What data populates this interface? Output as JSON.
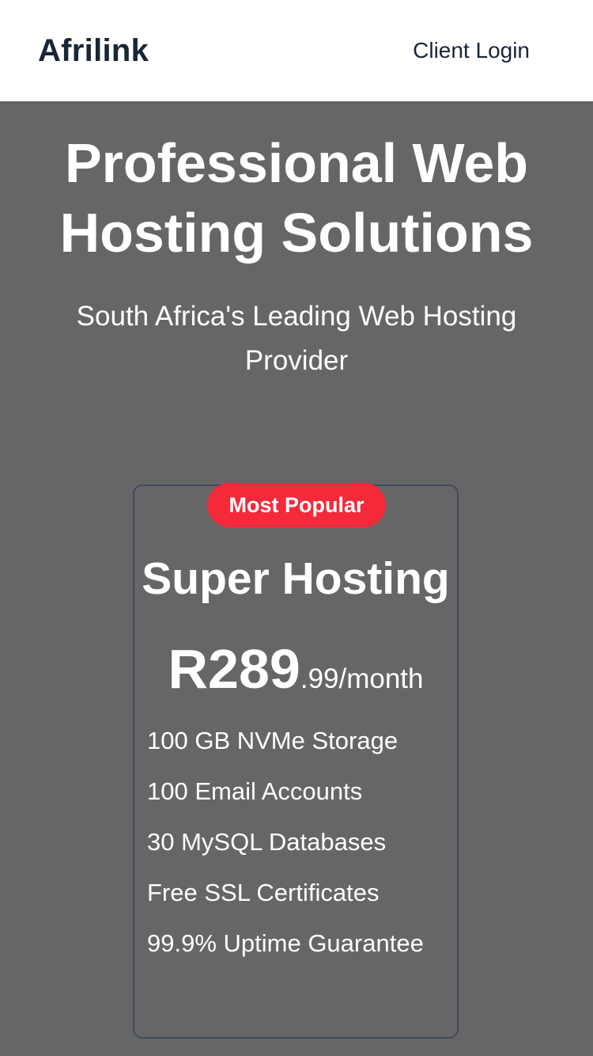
{
  "nav": {
    "brand": "Afrilink",
    "client_login": "Client Login"
  },
  "hero": {
    "title": "Professional Web Hosting Solutions",
    "subtitle": "South Africa's Leading Web Hosting Provider"
  },
  "plan": {
    "badge": "Most Popular",
    "name": "Super Hosting",
    "price_main": "R289",
    "price_suffix": ".99/month",
    "features": [
      "100 GB NVMe Storage",
      "100 Email Accounts",
      "30 MySQL Databases",
      "Free SSL Certificates",
      "99.9% Uptime Guarantee"
    ]
  },
  "colors": {
    "navbar_bg": "#ffffff",
    "hero_bg": "#666666",
    "brand_text": "#1a2536",
    "badge_bg": "#f4293a",
    "card_border": "#3e4a5e"
  }
}
